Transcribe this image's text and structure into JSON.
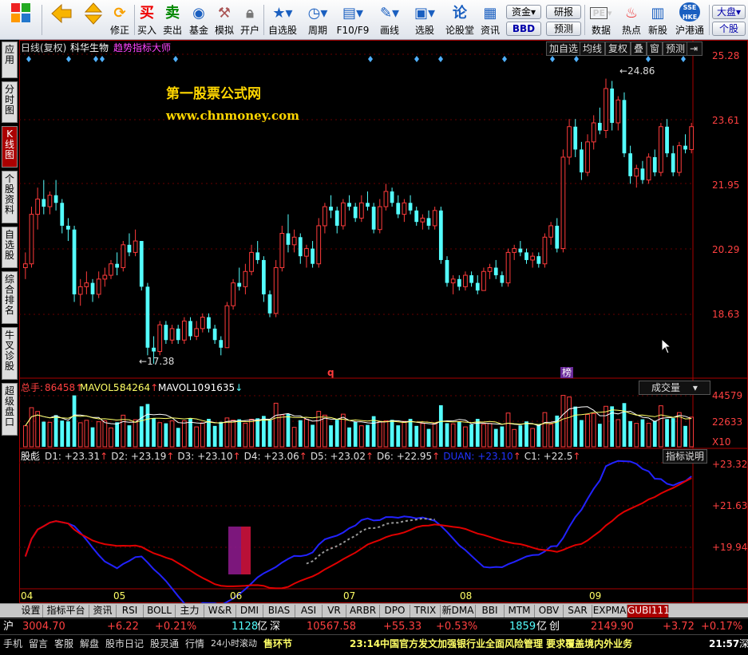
{
  "toolbar": {
    "buy": "买入",
    "sell": "卖出",
    "fund": "基金",
    "sim": "模拟",
    "open": "开户",
    "watchlist": "自选股",
    "period": "周期",
    "f10": "F10/F9",
    "draw": "画线",
    "pick": "选股",
    "forum": "论股堂",
    "news": "资讯",
    "capital": "资金",
    "bbd": "BBD",
    "research": "研报",
    "forecast": "预测",
    "data": "数据",
    "hot": "热点",
    "newstock": "新股",
    "hkconnect": "沪港通",
    "market_main": "大盘",
    "market_sub": "个股",
    "fix": "修正",
    "pe_icon_text": "PE",
    "hk_icon_text": "SSE HKE"
  },
  "left_tabs": [
    "应用",
    "分时图",
    "K线图",
    "个股资料",
    "自选股",
    "综合排名",
    "牛叉诊股",
    "超级盘口"
  ],
  "header": {
    "chart_label": "日线(复权)",
    "stock_name": "科华生物",
    "indicator_name": "趋势指标大师",
    "buttons": [
      "加自选",
      "均线",
      "复权",
      "叠",
      "窗",
      "预测"
    ]
  },
  "watermark": {
    "line1": "第一股票公式网",
    "line2": "www.chnmoney.com"
  },
  "price_axis": [
    "25.28",
    "23.61",
    "21.95",
    "20.29",
    "18.63"
  ],
  "annotations": {
    "high": "24.86",
    "low": "17.38",
    "q_marker": "q",
    "bang_marker": "榜"
  },
  "volume": {
    "label_total": "总手:",
    "total": "86458",
    "mavol5_label": "MAVOL5:",
    "mavol5": "84264",
    "mavol10_label": "MAVOL10:",
    "mavol10": "91635",
    "selector": "成交量",
    "axis": [
      "44579",
      "22633"
    ],
    "axis_unit": "X10"
  },
  "indicator": {
    "name": "股彪",
    "values": [
      {
        "key": "D1:",
        "val": "+23.31",
        "color": "#e0e0e0"
      },
      {
        "key": "D2:",
        "val": "+23.19",
        "color": "#e0e0e0"
      },
      {
        "key": "D3:",
        "val": "+23.10",
        "color": "#e0e0e0"
      },
      {
        "key": "D4:",
        "val": "+23.06",
        "color": "#e0e0e0"
      },
      {
        "key": "D5:",
        "val": "+23.02",
        "color": "#e0e0e0"
      },
      {
        "key": "D6:",
        "val": "+22.95",
        "color": "#e0e0e0"
      },
      {
        "key": "DUAN:",
        "val": "+23.10",
        "color": "#2233ff"
      },
      {
        "key": "C1:",
        "val": "+22.5",
        "color": "#e0e0e0"
      }
    ],
    "help": "指标说明",
    "axis": [
      "+23.32",
      "+21.63",
      "+19.94"
    ]
  },
  "date_axis": [
    "04",
    "05",
    "06",
    "07",
    "08",
    "09"
  ],
  "bottom_tabs": [
    "设置",
    "指标平台",
    "资讯",
    "RSI",
    "BOLL",
    "主力",
    "W&R",
    "DMI",
    "BIAS",
    "ASI",
    "VR",
    "ARBR",
    "DPO",
    "TRIX",
    "新DMA",
    "BBI",
    "MTM",
    "OBV",
    "SAR",
    "EXPMA",
    "GUBI111"
  ],
  "index_bar": {
    "sh_label": "沪",
    "sh_value": "3004.70",
    "sh_change": "+6.22",
    "sh_pct": "+0.21%",
    "sh_amount": "1128",
    "sh_unit": "亿",
    "sz_label": "深",
    "sz_value": "10567.58",
    "sz_change": "+55.33",
    "sz_pct": "+0.53%",
    "sz_amount": "1859",
    "sz_unit": "亿",
    "cy_label": "创",
    "cy_value": "2149.90",
    "cy_change": "+3.72",
    "cy_pct": "+0.17%"
  },
  "status_bar": {
    "items": [
      "手机",
      "留言",
      "客服",
      "解盘",
      "股市日记",
      "股灵通",
      "行情",
      "24小时滚动",
      "售环节"
    ],
    "news_time": "23:14",
    "news": "中国官方发文加强银行业全面风险管理 要求覆盖境内外业务",
    "clock": "21:57",
    "clock_suffix": "深"
  },
  "colors": {
    "up": "#ff3b3b",
    "down": "#54ffff",
    "blue_line": "#2222ff",
    "red_line": "#e00000",
    "accent": "#ff44ff"
  },
  "chart_data": {
    "type": "candlestick",
    "price_range": [
      17.0,
      25.5
    ],
    "candles": [
      [
        19.9,
        20.3,
        19.6,
        20.0
      ],
      [
        20.0,
        21.5,
        19.9,
        21.3
      ],
      [
        21.3,
        22.0,
        20.9,
        21.7
      ],
      [
        21.7,
        22.2,
        21.3,
        21.5
      ],
      [
        21.5,
        21.9,
        21.3,
        21.8
      ],
      [
        21.8,
        22.2,
        21.4,
        21.6
      ],
      [
        21.6,
        21.7,
        20.8,
        21.0
      ],
      [
        21.0,
        21.2,
        20.6,
        20.9
      ],
      [
        20.9,
        21.0,
        19.0,
        19.2
      ],
      [
        19.2,
        19.6,
        18.9,
        19.4
      ],
      [
        19.4,
        19.8,
        19.2,
        19.5
      ],
      [
        19.5,
        19.6,
        19.0,
        19.2
      ],
      [
        19.2,
        19.8,
        19.1,
        19.6
      ],
      [
        19.6,
        19.9,
        19.4,
        19.7
      ],
      [
        19.7,
        20.1,
        19.6,
        20.0
      ],
      [
        20.0,
        20.3,
        19.7,
        19.9
      ],
      [
        19.9,
        20.6,
        19.8,
        20.5
      ],
      [
        20.5,
        20.8,
        20.2,
        20.3
      ],
      [
        20.3,
        20.9,
        20.2,
        20.6
      ],
      [
        20.6,
        20.6,
        19.3,
        19.4
      ],
      [
        19.4,
        19.5,
        17.6,
        17.8
      ],
      [
        17.8,
        18.1,
        17.38,
        17.7
      ],
      [
        17.7,
        18.5,
        17.6,
        18.4
      ],
      [
        18.4,
        18.5,
        17.9,
        18.0
      ],
      [
        18.0,
        18.4,
        17.9,
        18.3
      ],
      [
        18.3,
        18.4,
        17.9,
        18.0
      ],
      [
        18.0,
        18.6,
        17.9,
        18.5
      ],
      [
        18.5,
        18.6,
        18.0,
        18.1
      ],
      [
        18.1,
        18.5,
        18.0,
        18.3
      ],
      [
        18.3,
        18.7,
        18.2,
        18.6
      ],
      [
        18.6,
        18.7,
        18.2,
        18.3
      ],
      [
        18.3,
        18.4,
        17.9,
        18.0
      ],
      [
        18.0,
        18.1,
        17.6,
        17.8
      ],
      [
        17.8,
        19.0,
        17.8,
        18.9
      ],
      [
        18.9,
        19.6,
        18.8,
        19.5
      ],
      [
        19.5,
        19.9,
        19.3,
        19.4
      ],
      [
        19.4,
        20.0,
        19.2,
        19.8
      ],
      [
        19.8,
        20.5,
        19.7,
        20.3
      ],
      [
        20.3,
        20.6,
        20.0,
        20.1
      ],
      [
        20.1,
        20.2,
        19.0,
        19.2
      ],
      [
        19.2,
        19.3,
        18.6,
        18.7
      ],
      [
        18.7,
        20.1,
        18.6,
        19.9
      ],
      [
        19.9,
        21.0,
        19.8,
        20.8
      ],
      [
        20.8,
        21.3,
        20.3,
        20.5
      ],
      [
        20.5,
        20.9,
        20.3,
        20.7
      ],
      [
        20.7,
        20.8,
        20.0,
        20.2
      ],
      [
        20.2,
        20.5,
        19.9,
        20.4
      ],
      [
        20.4,
        20.6,
        19.9,
        20.0
      ],
      [
        20.0,
        21.2,
        19.9,
        21.0
      ],
      [
        21.0,
        21.6,
        20.8,
        21.5
      ],
      [
        21.5,
        21.8,
        21.2,
        21.4
      ],
      [
        21.4,
        21.5,
        20.8,
        21.0
      ],
      [
        21.0,
        21.7,
        20.9,
        21.6
      ],
      [
        21.6,
        21.8,
        21.4,
        21.5
      ],
      [
        21.5,
        21.6,
        21.1,
        21.2
      ],
      [
        21.2,
        21.8,
        21.1,
        21.6
      ],
      [
        21.6,
        21.9,
        21.4,
        21.5
      ],
      [
        21.5,
        21.6,
        20.8,
        20.9
      ],
      [
        20.9,
        21.7,
        20.8,
        21.5
      ],
      [
        21.5,
        22.1,
        21.4,
        21.9
      ],
      [
        21.9,
        22.0,
        21.5,
        21.6
      ],
      [
        21.6,
        21.8,
        21.2,
        21.3
      ],
      [
        21.3,
        21.7,
        21.1,
        21.6
      ],
      [
        21.6,
        21.8,
        21.3,
        21.4
      ],
      [
        21.4,
        21.5,
        21.0,
        21.1
      ],
      [
        21.1,
        21.3,
        20.9,
        21.2
      ],
      [
        21.2,
        21.4,
        20.9,
        21.0
      ],
      [
        21.0,
        21.5,
        20.9,
        21.4
      ],
      [
        21.4,
        21.5,
        20.0,
        20.1
      ],
      [
        20.1,
        20.2,
        19.4,
        19.5
      ],
      [
        19.5,
        19.7,
        19.2,
        19.6
      ],
      [
        19.6,
        19.7,
        19.3,
        19.4
      ],
      [
        19.4,
        19.8,
        19.3,
        19.7
      ],
      [
        19.7,
        19.8,
        19.4,
        19.5
      ],
      [
        19.5,
        19.7,
        19.2,
        19.3
      ],
      [
        19.3,
        19.9,
        19.3,
        19.8
      ],
      [
        19.8,
        20.0,
        19.6,
        19.9
      ],
      [
        19.9,
        20.1,
        19.6,
        19.7
      ],
      [
        19.7,
        19.8,
        19.4,
        19.5
      ],
      [
        19.5,
        20.4,
        19.4,
        20.3
      ],
      [
        20.3,
        20.5,
        20.1,
        20.4
      ],
      [
        20.4,
        20.6,
        20.2,
        20.3
      ],
      [
        20.3,
        20.4,
        20.0,
        20.1
      ],
      [
        20.1,
        20.3,
        19.9,
        20.2
      ],
      [
        20.2,
        20.3,
        19.9,
        20.0
      ],
      [
        20.0,
        20.8,
        19.9,
        20.7
      ],
      [
        20.7,
        21.1,
        20.5,
        21.0
      ],
      [
        21.0,
        21.2,
        20.3,
        20.4
      ],
      [
        20.4,
        23.0,
        20.3,
        22.8
      ],
      [
        22.8,
        23.8,
        22.6,
        23.6
      ],
      [
        23.6,
        23.8,
        22.8,
        23.0
      ],
      [
        23.0,
        23.2,
        22.2,
        22.4
      ],
      [
        22.4,
        23.4,
        22.3,
        23.2
      ],
      [
        23.2,
        23.9,
        23.0,
        23.7
      ],
      [
        23.7,
        24.1,
        23.4,
        23.5
      ],
      [
        23.5,
        24.86,
        23.3,
        24.6
      ],
      [
        24.6,
        24.8,
        23.5,
        23.7
      ],
      [
        23.7,
        24.4,
        23.5,
        24.3
      ],
      [
        24.3,
        24.5,
        22.8,
        22.9
      ],
      [
        22.9,
        23.1,
        22.1,
        22.3
      ],
      [
        22.3,
        22.6,
        22.0,
        22.5
      ],
      [
        22.5,
        22.7,
        22.1,
        22.2
      ],
      [
        22.2,
        22.9,
        22.1,
        22.8
      ],
      [
        22.8,
        23.0,
        22.3,
        22.4
      ],
      [
        22.4,
        23.7,
        22.3,
        23.6
      ],
      [
        23.6,
        23.8,
        22.8,
        22.9
      ],
      [
        22.9,
        23.1,
        22.3,
        22.4
      ],
      [
        22.4,
        23.2,
        22.3,
        23.1
      ],
      [
        23.1,
        23.4,
        22.9,
        23.0
      ],
      [
        23.0,
        23.7,
        22.9,
        23.6
      ]
    ],
    "volume_range": [
      0,
      50000
    ],
    "dates": [
      "04",
      "05",
      "06",
      "07",
      "08",
      "09"
    ],
    "indicator_range": [
      18.8,
      23.6
    ]
  }
}
